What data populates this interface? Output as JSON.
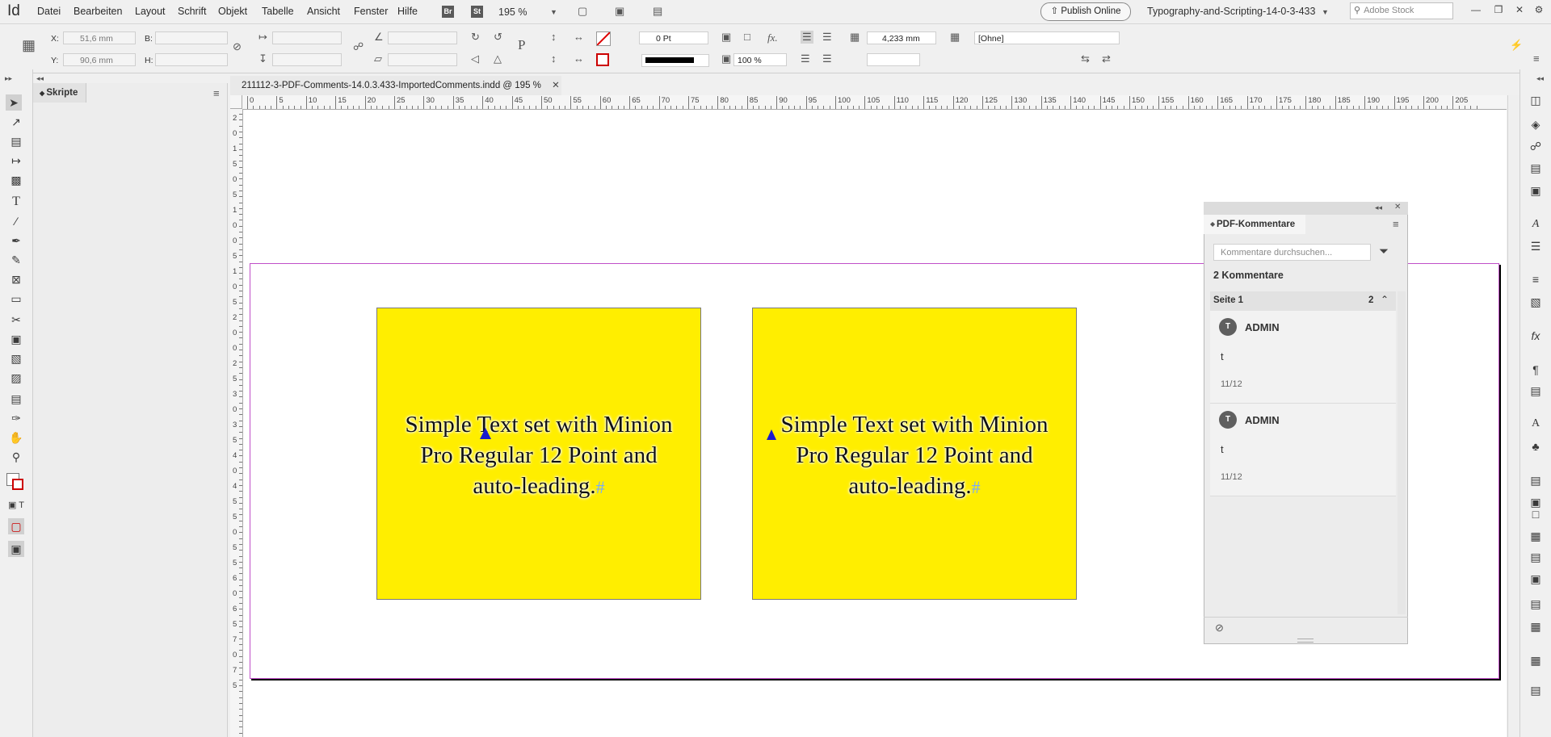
{
  "app": {
    "logo": "Id"
  },
  "menu": [
    "Datei",
    "Bearbeiten",
    "Layout",
    "Schrift",
    "Objekt",
    "Tabelle",
    "Ansicht",
    "Fenster",
    "Hilfe"
  ],
  "menubar": {
    "br": "Br",
    "st": "St",
    "zoom": "195 %",
    "publish": "Publish Online",
    "workspace": "Typography-and-Scripting-14-0-3-433",
    "stock_placeholder": "Adobe Stock"
  },
  "controlbar": {
    "x_label": "X:",
    "x_value": "51,6 mm",
    "y_label": "Y:",
    "y_value": "90,6 mm",
    "w_label": "B:",
    "h_label": "H:",
    "stroke_weight": "0 Pt",
    "offset": "4,233 mm",
    "opacity": "100 %",
    "object_style": "[Ohne]"
  },
  "scripts_panel": {
    "tab": "Skripte"
  },
  "document": {
    "tab_title": "211112-3-PDF-Comments-14.0.3.433-ImportedComments.indd @ 195 %"
  },
  "ruler": {
    "h_labels": [
      "0",
      "5",
      "10",
      "15",
      "20",
      "25",
      "30",
      "35",
      "40",
      "45",
      "50",
      "55",
      "60",
      "65",
      "70",
      "75",
      "80",
      "85",
      "90",
      "95",
      "100",
      "105",
      "110",
      "115",
      "120",
      "125",
      "130",
      "135",
      "140",
      "145",
      "150",
      "155",
      "160",
      "165",
      "170",
      "175",
      "180",
      "185",
      "190",
      "195",
      "200",
      "205"
    ],
    "v_labels": [
      "2",
      "0",
      "1",
      "5",
      "0",
      "5",
      "1",
      "0",
      "0",
      "5",
      "1",
      "0",
      "5",
      "2",
      "0",
      "0",
      "2",
      "5",
      "3",
      "0",
      "3",
      "5",
      "4",
      "0",
      "4",
      "5",
      "5",
      "0",
      "5",
      "5",
      "6",
      "0",
      "6",
      "5",
      "7",
      "0",
      "7",
      "5"
    ]
  },
  "frames": [
    {
      "lines": [
        "Simple Text set with Minion",
        "Pro Regular 12 Point and",
        "auto-leading."
      ],
      "pilcrow": "#"
    },
    {
      "lines": [
        "Simple Text set with Minion",
        "Pro Regular 12 Point and",
        "auto-leading."
      ],
      "pilcrow": "#"
    }
  ],
  "pdf_panel": {
    "title": "PDF-Kommentare",
    "search_placeholder": "Kommentare durchsuchen...",
    "count_label": "2 Kommentare",
    "page_label": "Seite 1",
    "page_count": "2",
    "comments": [
      {
        "author": "ADMIN",
        "avatar": "T",
        "body": "t",
        "date": "11/12"
      },
      {
        "author": "ADMIN",
        "avatar": "T",
        "body": "t",
        "date": "11/12"
      }
    ]
  },
  "colors": {
    "frame_fill": "#ffee00",
    "marker": "#1a1acc",
    "page_border": "#c04fc8"
  }
}
